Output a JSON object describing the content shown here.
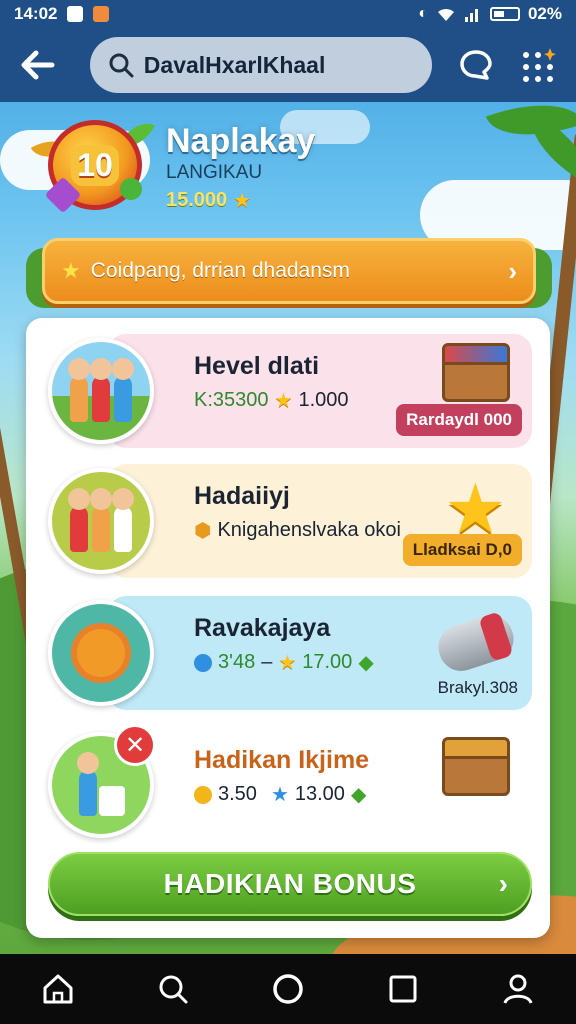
{
  "status_bar": {
    "time": "14:02",
    "battery": "02%"
  },
  "app_bar": {
    "search_query": "DavalHxarlKhaal"
  },
  "header": {
    "badge_level": "10",
    "title": "Naplakay",
    "subtitle": "LANGIKAU",
    "score": "15.000"
  },
  "banner": {
    "text": "Coidpang, drrian dhadansm"
  },
  "rows": [
    {
      "title": "Hevel dlati",
      "stat_a": "K:35300",
      "stat_b": "1.000",
      "action": "Rardaydl 000"
    },
    {
      "title": "Hadaiiyj",
      "stat_a": "Knigahenslvaka okoi",
      "action": "Lladksai D,0"
    },
    {
      "title": "Ravakajaya",
      "stat_a": "3'48",
      "stat_sep": "–",
      "stat_b": "17.00",
      "action": "Brakyl.308"
    },
    {
      "title": "Hadikan Ikjime",
      "stat_a": "3.50",
      "stat_b": "13.00"
    }
  ],
  "bonus_button": {
    "label": "HADIKIAN BONUS"
  },
  "colors": {
    "app_bar": "#1f4f86",
    "banner": "#ec8d1c",
    "bonus": "#4d9f22",
    "row_pink": "#fbe1ea",
    "row_cream": "#fdf2d8",
    "row_blue": "#bfe9f7"
  }
}
